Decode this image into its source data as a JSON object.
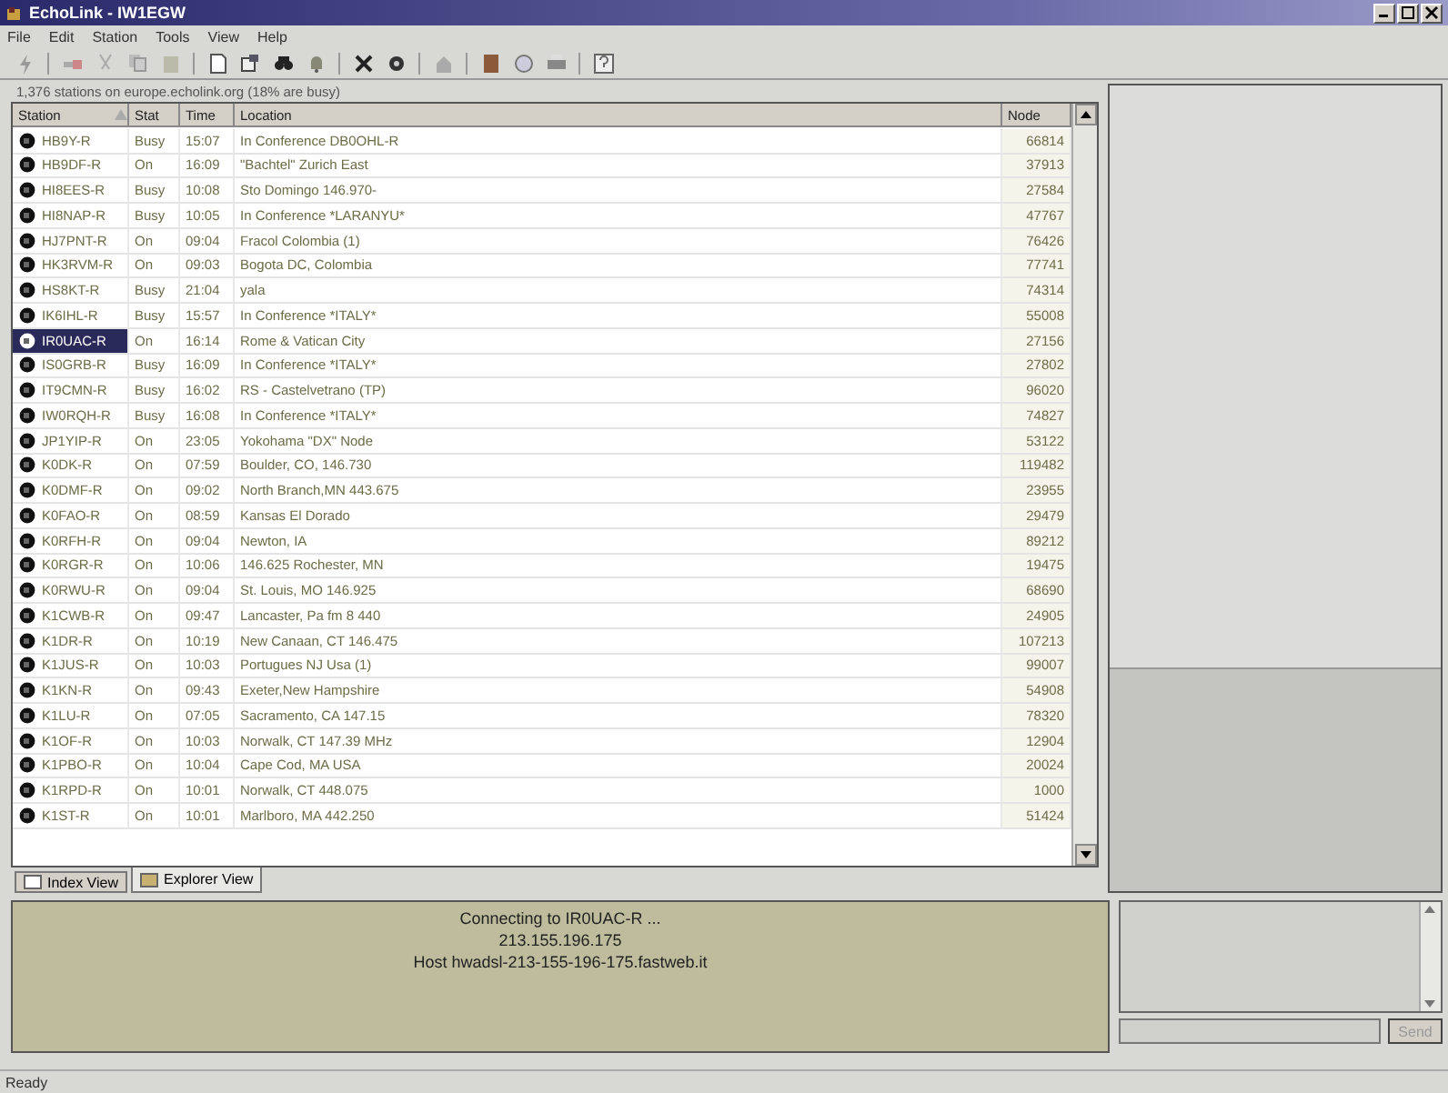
{
  "window": {
    "title": "EchoLink - IW1EGW"
  },
  "menu": [
    "File",
    "Edit",
    "Station",
    "Tools",
    "View",
    "Help"
  ],
  "station_list": {
    "summary": "1,376 stations on europe.echolink.org (18% are busy)",
    "columns": [
      "Station",
      "Stat",
      "Time",
      "Location",
      "Node"
    ],
    "rows": [
      {
        "station": "HB9Y-R",
        "status": "Busy",
        "time": "15:07",
        "location": "In Conference DB0OHL-R",
        "node": "66814",
        "selected": false
      },
      {
        "station": "HB9DF-R",
        "status": "On",
        "time": "16:09",
        "location": "\"Bachtel\" Zurich East",
        "node": "37913",
        "selected": false
      },
      {
        "station": "HI8EES-R",
        "status": "Busy",
        "time": "10:08",
        "location": "Sto Domingo 146.970-",
        "node": "27584",
        "selected": false
      },
      {
        "station": "HI8NAP-R",
        "status": "Busy",
        "time": "10:05",
        "location": "In Conference *LARANYU*",
        "node": "47767",
        "selected": false
      },
      {
        "station": "HJ7PNT-R",
        "status": "On",
        "time": "09:04",
        "location": "Fracol Colombia (1)",
        "node": "76426",
        "selected": false
      },
      {
        "station": "HK3RVM-R",
        "status": "On",
        "time": "09:03",
        "location": "Bogota DC, Colombia",
        "node": "77741",
        "selected": false
      },
      {
        "station": "HS8KT-R",
        "status": "Busy",
        "time": "21:04",
        "location": "yala",
        "node": "74314",
        "selected": false
      },
      {
        "station": "IK6IHL-R",
        "status": "Busy",
        "time": "15:57",
        "location": "In Conference *ITALY*",
        "node": "55008",
        "selected": false
      },
      {
        "station": "IR0UAC-R",
        "status": "On",
        "time": "16:14",
        "location": "Rome & Vatican City",
        "node": "27156",
        "selected": true
      },
      {
        "station": "IS0GRB-R",
        "status": "Busy",
        "time": "16:09",
        "location": "In Conference *ITALY*",
        "node": "27802",
        "selected": false
      },
      {
        "station": "IT9CMN-R",
        "status": "Busy",
        "time": "16:02",
        "location": "RS - Castelvetrano (TP)",
        "node": "96020",
        "selected": false
      },
      {
        "station": "IW0RQH-R",
        "status": "Busy",
        "time": "16:08",
        "location": "In Conference *ITALY*",
        "node": "74827",
        "selected": false
      },
      {
        "station": "JP1YIP-R",
        "status": "On",
        "time": "23:05",
        "location": "Yokohama \"DX\" Node",
        "node": "53122",
        "selected": false
      },
      {
        "station": "K0DK-R",
        "status": "On",
        "time": "07:59",
        "location": "Boulder, CO, 146.730",
        "node": "119482",
        "selected": false
      },
      {
        "station": "K0DMF-R",
        "status": "On",
        "time": "09:02",
        "location": "North Branch,MN 443.675",
        "node": "23955",
        "selected": false
      },
      {
        "station": "K0FAO-R",
        "status": "On",
        "time": "08:59",
        "location": "Kansas El Dorado",
        "node": "29479",
        "selected": false
      },
      {
        "station": "K0RFH-R",
        "status": "On",
        "time": "09:04",
        "location": "Newton, IA",
        "node": "89212",
        "selected": false
      },
      {
        "station": "K0RGR-R",
        "status": "On",
        "time": "10:06",
        "location": "146.625 Rochester, MN",
        "node": "19475",
        "selected": false
      },
      {
        "station": "K0RWU-R",
        "status": "On",
        "time": "09:04",
        "location": "St. Louis, MO 146.925",
        "node": "68690",
        "selected": false
      },
      {
        "station": "K1CWB-R",
        "status": "On",
        "time": "09:47",
        "location": "Lancaster, Pa fm 8 440",
        "node": "24905",
        "selected": false
      },
      {
        "station": "K1DR-R",
        "status": "On",
        "time": "10:19",
        "location": "New Canaan, CT 146.475",
        "node": "107213",
        "selected": false
      },
      {
        "station": "K1JUS-R",
        "status": "On",
        "time": "10:03",
        "location": "Portugues NJ Usa (1)",
        "node": "99007",
        "selected": false
      },
      {
        "station": "K1KN-R",
        "status": "On",
        "time": "09:43",
        "location": "Exeter,New Hampshire",
        "node": "54908",
        "selected": false
      },
      {
        "station": "K1LU-R",
        "status": "On",
        "time": "07:05",
        "location": "Sacramento, CA 147.15",
        "node": "78320",
        "selected": false
      },
      {
        "station": "K1OF-R",
        "status": "On",
        "time": "10:03",
        "location": "Norwalk, CT 147.39 MHz",
        "node": "12904",
        "selected": false
      },
      {
        "station": "K1PBO-R",
        "status": "On",
        "time": "10:04",
        "location": "Cape Cod, MA USA",
        "node": "20024",
        "selected": false
      },
      {
        "station": "K1RPD-R",
        "status": "On",
        "time": "10:01",
        "location": "Norwalk, CT 448.075",
        "node": "1000",
        "selected": false
      },
      {
        "station": "K1ST-R",
        "status": "On",
        "time": "10:01",
        "location": "Marlboro, MA 442.250",
        "node": "51424",
        "selected": false
      }
    ]
  },
  "view_tabs": [
    {
      "label": "Index View",
      "selected": false
    },
    {
      "label": "Explorer View",
      "selected": true
    }
  ],
  "connection_log": [
    "Connecting to IR0UAC-R ...",
    "213.155.196.175",
    "Host hwadsl-213-155-196-175.fastweb.it"
  ],
  "chat": {
    "send_button": "Send",
    "send_disabled": true
  },
  "status_bar": "Ready"
}
